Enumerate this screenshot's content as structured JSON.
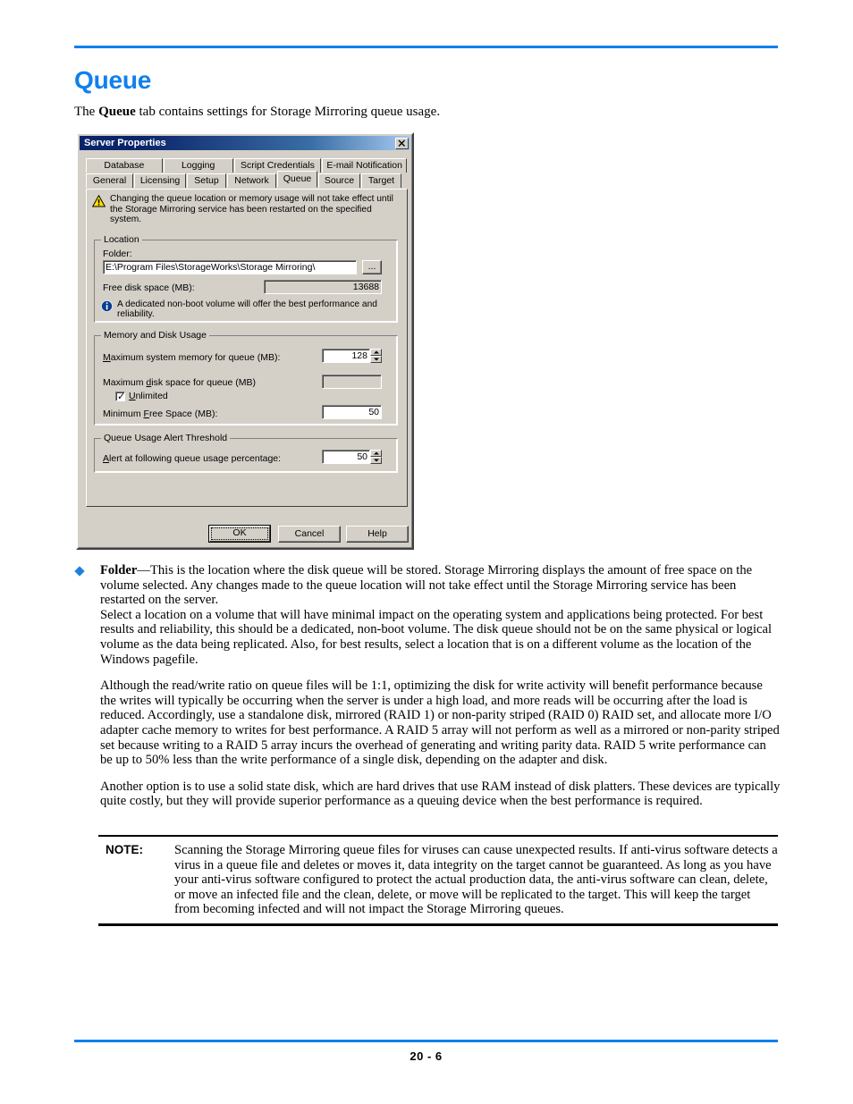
{
  "page": {
    "title": "Queue",
    "intro_before": "The ",
    "intro_bold": "Queue",
    "intro_after": " tab contains settings for Storage Mirroring queue usage.",
    "page_number": "20 - 6",
    "accent_color": "#1080ee"
  },
  "dialog": {
    "titlebar": "Server Properties",
    "close_label": "✕",
    "tabs_row1": [
      "Database",
      "Logging",
      "Script Credentials",
      "E-mail Notification"
    ],
    "tabs_row2": [
      "General",
      "Licensing",
      "Setup",
      "Network",
      "Queue",
      "Source",
      "Target"
    ],
    "active_tab": "Queue",
    "warning_text": "Changing the queue location or memory usage will not take effect until the Storage Mirroring service has been restarted on the specified system.",
    "location": {
      "group_title": "Location",
      "folder_label": "Folder:",
      "folder_value": "E:\\Program Files\\StorageWorks\\Storage Mirroring\\",
      "browse_label": "...",
      "free_disk_label": "Free disk space (MB):",
      "free_disk_value": "13688",
      "info_text": "A dedicated non-boot volume will offer the best performance and reliability."
    },
    "memory": {
      "group_title": "Memory and Disk Usage",
      "max_system_memory_label": "Maximum system memory for queue (MB):",
      "max_system_memory_value": "128",
      "max_disk_space_label": "Maximum disk space for queue (MB)",
      "max_disk_space_value": "",
      "unlimited_label": "Unlimited",
      "unlimited_checked": "✓",
      "min_free_space_label": "Minimum Free Space (MB):",
      "min_free_space_value": "50"
    },
    "alert": {
      "group_title": "Queue Usage Alert Threshold",
      "alert_label": "Alert at following queue usage percentage:",
      "alert_value": "50"
    },
    "buttons": {
      "ok": "OK",
      "cancel": "Cancel",
      "help": "Help"
    }
  },
  "body": {
    "bullet_lead": "Folder",
    "bullet_para": "—This is the location where the disk queue will be stored. Storage Mirroring displays the amount of free space on the volume selected. Any changes made to the queue location will not take effect until the Storage Mirroring service has been restarted on the server.",
    "para2": "Select a location on a volume that will have minimal impact on the operating system and applications being protected. For best results and reliability, this should be a dedicated, non-boot volume. The disk queue should not be on the same physical or logical volume as the data being replicated. Also, for best results, select a location that is on a different volume as the location of the Windows pagefile.",
    "para3": "Although the read/write ratio on queue files will be 1:1, optimizing the disk for write activity will benefit performance because the writes will typically be occurring when the server is under a high load, and more reads will be occurring after the load is reduced. Accordingly, use a standalone disk, mirrored (RAID 1) or non-parity striped (RAID 0) RAID set, and allocate more I/O adapter cache memory to writes for best performance. A RAID 5 array will not perform as well as a mirrored or non-parity striped set because writing to a RAID 5 array incurs the overhead of generating and writing parity data. RAID 5 write performance can be up to 50% less than the write performance of a single disk, depending on the adapter and disk.",
    "para4": "Another option is to use a solid state disk, which are hard drives that use RAM instead of disk platters. These devices are typically quite costly, but they will provide superior performance as a queuing device when the best performance is required."
  },
  "note": {
    "label": "NOTE:",
    "text": "Scanning the Storage Mirroring queue files for viruses can cause unexpected results. If anti-virus software detects a virus in a queue file and deletes or moves it, data integrity on the target cannot be guaranteed. As long as you have your anti-virus software configured to protect the actual production data, the anti-virus software can clean, delete, or move an infected file and the clean, delete, or move will be replicated to the target. This will keep the target from becoming infected and will not impact the Storage Mirroring queues."
  }
}
